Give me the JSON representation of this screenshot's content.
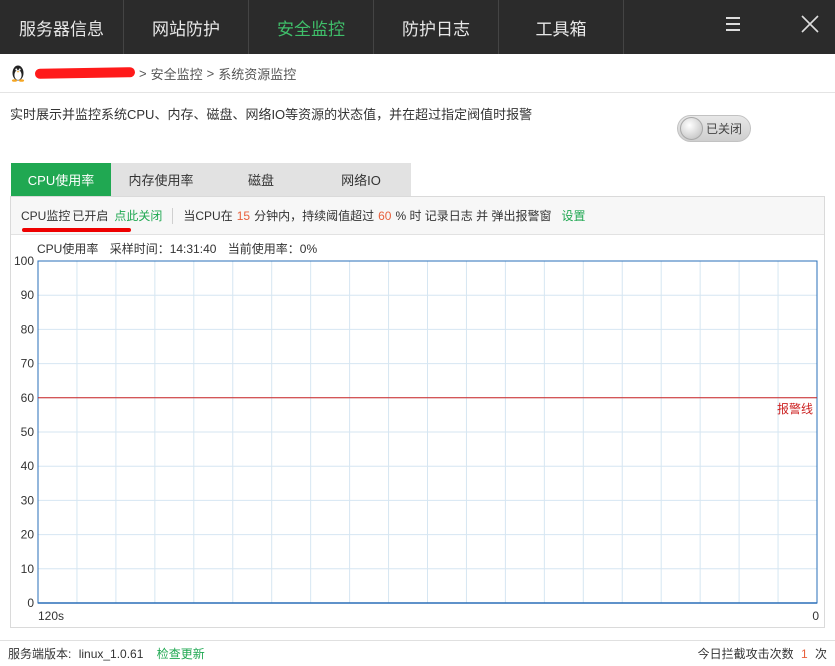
{
  "nav": {
    "items": [
      {
        "label": "服务器信息",
        "active": false
      },
      {
        "label": "网站防护",
        "active": false
      },
      {
        "label": "安全监控",
        "active": true
      },
      {
        "label": "防护日志",
        "active": false
      },
      {
        "label": "工具箱",
        "active": false
      }
    ],
    "menu_icon": "hamburger-icon",
    "close_icon": "close-icon"
  },
  "breadcrumb": {
    "icon": "linux-penguin-icon",
    "sep": ">",
    "items": [
      "安全监控",
      "系统资源监控"
    ]
  },
  "description": "实时展示并监控系统CPU、内存、磁盘、网络IO等资源的状态值，并在超过指定阀值时报警",
  "toggle": {
    "label": "已关闭"
  },
  "tabs": [
    "CPU使用率",
    "内存使用率",
    "磁盘",
    "网络IO"
  ],
  "status": {
    "prefix": "CPU监控",
    "state": "已开启",
    "action": "点此关闭",
    "rule_1": "当CPU在",
    "minutes": "15",
    "rule_2": "分钟内，持续阈值超过",
    "threshold": "60",
    "rule_3": "% 时 记录日志 并 弹出报警窗",
    "settings": "设置"
  },
  "chart_info": {
    "name": "CPU使用率",
    "sample_label": "采样时间：",
    "sample_time": "14:31:40",
    "current_label": "当前使用率：",
    "current_value": "0%"
  },
  "chart_data": {
    "type": "line",
    "y_ticks": [
      "100",
      "90",
      "80",
      "70",
      "60",
      "50",
      "40",
      "30",
      "20",
      "10",
      "0"
    ],
    "x_start_label": "120s",
    "x_end_label": "0",
    "ylim": [
      0,
      100
    ],
    "grid": true,
    "threshold": {
      "value": 60,
      "label": "报警线",
      "color": "#cc2222"
    },
    "series": [
      {
        "values": [
          0,
          0
        ],
        "color": "#2a6fb8"
      }
    ],
    "line_color": "#2a6fb8",
    "grid_color": "#d6e6f2"
  },
  "footer": {
    "version_label": "服务端版本:",
    "version": "linux_1.0.61",
    "check_update": "检查更新",
    "attacks_label": "今日拦截攻击次数",
    "attacks_count": "1",
    "attacks_unit": "次"
  }
}
